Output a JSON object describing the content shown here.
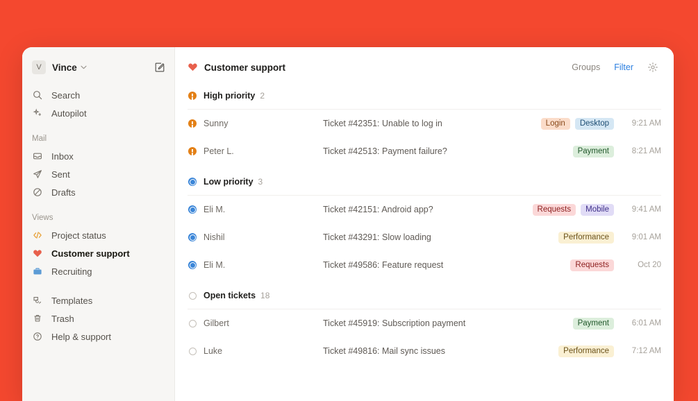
{
  "desktop": {
    "background_color": "#F4482F"
  },
  "sidebar": {
    "account": {
      "avatar_initial": "V",
      "name": "Vince",
      "caret": "⌄"
    },
    "primary": [
      {
        "icon": "search-icon",
        "label": "Search"
      },
      {
        "icon": "sparkle-icon",
        "label": "Autopilot"
      }
    ],
    "mail_group_label": "Mail",
    "mail": [
      {
        "icon": "inbox-icon",
        "label": "Inbox"
      },
      {
        "icon": "paper-plane-icon",
        "label": "Sent"
      },
      {
        "icon": "drafts-icon",
        "label": "Drafts"
      }
    ],
    "views_group_label": "Views",
    "views": [
      {
        "icon": "code-icon",
        "label": "Project status",
        "color": "#E8A33D",
        "active": false
      },
      {
        "icon": "heart-icon",
        "label": "Customer support",
        "color": "#E8604C",
        "active": true
      },
      {
        "icon": "briefcase-icon",
        "label": "Recruiting",
        "color": "#5B9BD5",
        "active": false
      }
    ],
    "utility": [
      {
        "icon": "templates-icon",
        "label": "Templates"
      },
      {
        "icon": "trash-icon",
        "label": "Trash"
      },
      {
        "icon": "help-circle-icon",
        "label": "Help & support"
      }
    ]
  },
  "header": {
    "icon": "heart-icon",
    "title": "Customer support",
    "groups_label": "Groups",
    "filter_label": "Filter",
    "settings_icon": "gear-icon",
    "accent_color": "#2B7FE0"
  },
  "tag_styles": {
    "Login": {
      "bg": "#FBDCC9",
      "fg": "#8A4A1C"
    },
    "Desktop": {
      "bg": "#D5E7F4",
      "fg": "#1F4E73"
    },
    "Payment": {
      "bg": "#DCEEDC",
      "fg": "#20572A"
    },
    "Requests": {
      "bg": "#FBD8D8",
      "fg": "#8E2121"
    },
    "Mobile": {
      "bg": "#E1DCF6",
      "fg": "#3F2F8A"
    },
    "Performance": {
      "bg": "#FAF0D3",
      "fg": "#6B521A"
    }
  },
  "sections": [
    {
      "id": "high-priority",
      "title": "High priority",
      "count": "2",
      "icon": "high-priority-dot",
      "rows": [
        {
          "sender": "Sunny",
          "subject": "Ticket #42351: Unable to log in",
          "tags": [
            "Login",
            "Desktop"
          ],
          "time": "9:21 AM"
        },
        {
          "sender": "Peter L.",
          "subject": "Ticket #42513: Payment failure?",
          "tags": [
            "Payment"
          ],
          "time": "8:21 AM"
        }
      ]
    },
    {
      "id": "low-priority",
      "title": "Low priority",
      "count": "3",
      "icon": "low-priority-dot",
      "rows": [
        {
          "sender": "Eli M.",
          "subject": "Ticket #42151: Android app?",
          "tags": [
            "Requests",
            "Mobile"
          ],
          "time": "9:41 AM"
        },
        {
          "sender": "Nishil",
          "subject": "Ticket #43291: Slow loading",
          "tags": [
            "Performance"
          ],
          "time": "9:01 AM"
        },
        {
          "sender": "Eli M.",
          "subject": "Ticket #49586: Feature request",
          "tags": [
            "Requests"
          ],
          "time": "Oct 20"
        }
      ]
    },
    {
      "id": "open-tickets",
      "title": "Open tickets",
      "count": "18",
      "icon": "open-ticket-dot",
      "rows": [
        {
          "sender": "Gilbert",
          "subject": "Ticket #45919: Subscription payment",
          "tags": [
            "Payment"
          ],
          "time": "6:01 AM"
        },
        {
          "sender": "Luke",
          "subject": "Ticket #49816: Mail sync issues",
          "tags": [
            "Performance"
          ],
          "time": "7:12 AM"
        }
      ]
    }
  ]
}
